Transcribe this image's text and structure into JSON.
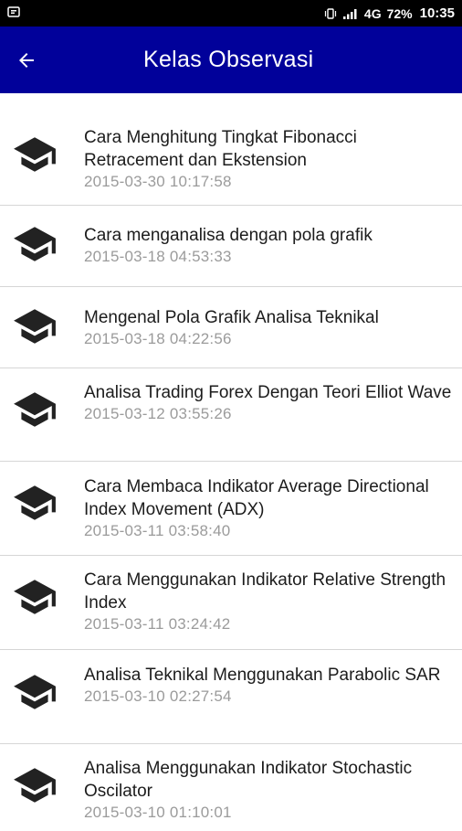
{
  "status_bar": {
    "network": "4G",
    "battery": "72%",
    "time": "10:35"
  },
  "app_bar": {
    "title": "Kelas Observasi"
  },
  "items": [
    {
      "title": "Cara Menghitung Tingkat Fibonacci Retracement dan Ekstension",
      "date": "2015-03-30 10:17:58"
    },
    {
      "title": "Cara menganalisa dengan pola grafik",
      "date": "2015-03-18 04:53:33"
    },
    {
      "title": "Mengenal Pola Grafik Analisa Teknikal",
      "date": "2015-03-18 04:22:56"
    },
    {
      "title": "Analisa Trading Forex Dengan Teori Elliot Wave",
      "date": "2015-03-12 03:55:26"
    },
    {
      "title": "Cara Membaca Indikator Average Directional Index Movement (ADX)",
      "date": "2015-03-11 03:58:40"
    },
    {
      "title": "Cara Menggunakan Indikator Relative Strength Index",
      "date": "2015-03-11 03:24:42"
    },
    {
      "title": "Analisa Teknikal Menggunakan Parabolic SAR",
      "date": "2015-03-10 02:27:54"
    },
    {
      "title": "Analisa Menggunakan Indikator Stochastic Oscilator",
      "date": "2015-03-10 01:10:01"
    }
  ]
}
